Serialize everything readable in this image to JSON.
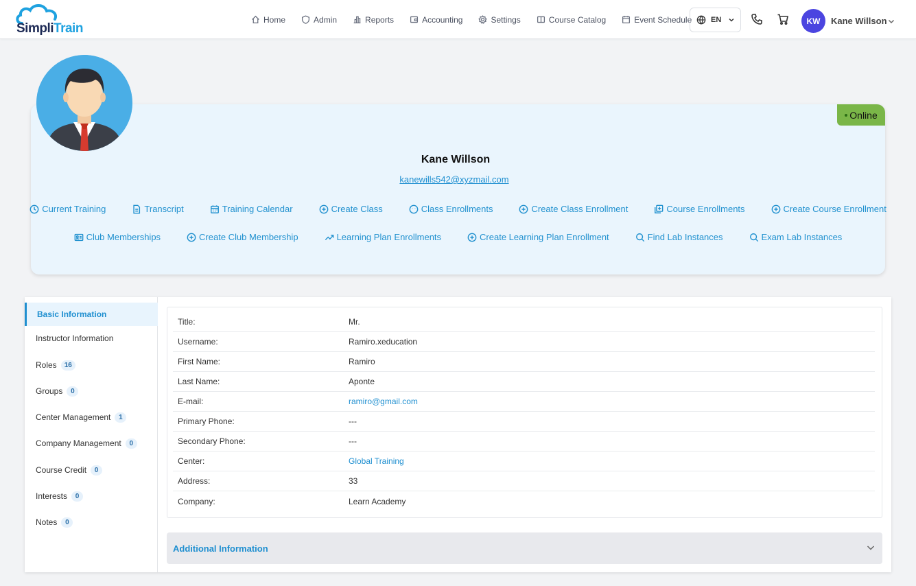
{
  "brand": {
    "logo_prefix": "Simpli",
    "logo_suffix": "Train"
  },
  "nav": [
    {
      "label": "Home",
      "icon": "home-icon"
    },
    {
      "label": "Admin",
      "icon": "shield-icon"
    },
    {
      "label": "Reports",
      "icon": "bar-chart-icon"
    },
    {
      "label": "Accounting",
      "icon": "wallet-icon"
    },
    {
      "label": "Settings",
      "icon": "gear-icon"
    },
    {
      "label": "Course Catalog",
      "icon": "book-icon"
    },
    {
      "label": "Event Schedule",
      "icon": "calendar-icon"
    }
  ],
  "language": {
    "code": "EN"
  },
  "user": {
    "initials": "KW",
    "name": "Kane Willson"
  },
  "profile": {
    "name": "Kane Willson",
    "email": "kanewills542@xyzmail.com",
    "status": "Online"
  },
  "actions_row1": [
    {
      "label": "Current Training",
      "icon": "clock-icon"
    },
    {
      "label": "Transcript",
      "icon": "document-icon"
    },
    {
      "label": "Training Calendar",
      "icon": "calendar-icon"
    },
    {
      "label": "Create Class",
      "icon": "plus-circle-icon"
    },
    {
      "label": "Class Enrollments",
      "icon": "smiley-icon"
    },
    {
      "label": "Create Class Enrollment",
      "icon": "plus-circle-icon"
    },
    {
      "label": "Course Enrollments",
      "icon": "copy-plus-icon"
    },
    {
      "label": "Create Course Enrollment",
      "icon": "plus-circle-icon"
    }
  ],
  "actions_row2": [
    {
      "label": "Club Memberships",
      "icon": "id-card-icon"
    },
    {
      "label": "Create Club Membership",
      "icon": "plus-circle-icon"
    },
    {
      "label": "Learning Plan Enrollments",
      "icon": "trending-up-icon"
    },
    {
      "label": "Create Learning Plan Enrollment",
      "icon": "plus-circle-icon"
    },
    {
      "label": "Find Lab Instances",
      "icon": "search-icon"
    },
    {
      "label": "Exam Lab Instances",
      "icon": "search-icon"
    }
  ],
  "sidebar": [
    {
      "label": "Basic Information",
      "count": null,
      "active": true
    },
    {
      "label": "Instructor Information",
      "count": null
    },
    {
      "label": "Roles",
      "count": "16"
    },
    {
      "label": "Groups",
      "count": "0"
    },
    {
      "label": "Center Management",
      "count": "1"
    },
    {
      "label": "Company Management",
      "count": "0"
    },
    {
      "label": "Course Credit",
      "count": "0"
    },
    {
      "label": "Interests",
      "count": "0"
    },
    {
      "label": "Notes",
      "count": "0"
    }
  ],
  "basic_info": [
    {
      "label": "Title:",
      "value": "Mr.",
      "link": false
    },
    {
      "label": "Username:",
      "value": "Ramiro.xeducation",
      "link": false
    },
    {
      "label": "First Name:",
      "value": "Ramiro",
      "link": false
    },
    {
      "label": "Last Name:",
      "value": "Aponte",
      "link": false
    },
    {
      "label": "E-mail:",
      "value": "ramiro@gmail.com",
      "link": true
    },
    {
      "label": "Primary Phone:",
      "value": "---",
      "link": false
    },
    {
      "label": "Secondary Phone:",
      "value": "---",
      "link": false
    },
    {
      "label": "Center:",
      "value": "Global Training",
      "link": true
    },
    {
      "label": "Address:",
      "value": "33",
      "link": false
    },
    {
      "label": "Company:",
      "value": "Learn Academy",
      "link": false
    }
  ],
  "additional": {
    "label": "Additional Information"
  }
}
